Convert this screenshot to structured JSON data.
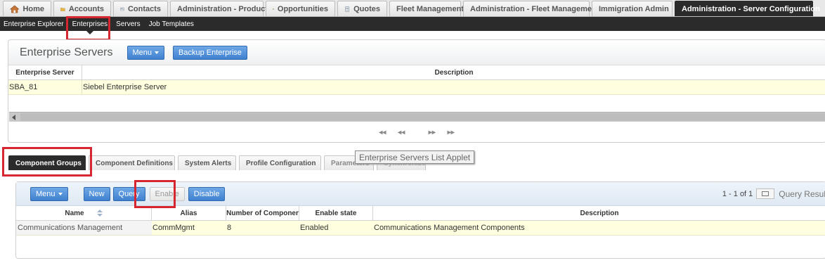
{
  "top_tabs": [
    {
      "label": "Home",
      "icon": "home-icon"
    },
    {
      "label": "Accounts",
      "icon": "folder-icon"
    },
    {
      "label": "Contacts",
      "icon": "contacts-icon"
    },
    {
      "label": "Administration - Product",
      "icon": ""
    },
    {
      "label": "Opportunities",
      "icon": "opportunities-icon"
    },
    {
      "label": "Quotes",
      "icon": "quotes-icon"
    },
    {
      "label": "Fleet Management",
      "icon": ""
    },
    {
      "label": "Administration - Fleet Management",
      "icon": ""
    },
    {
      "label": "Immigration Admin",
      "icon": ""
    },
    {
      "label": "Administration - Server Configuration",
      "icon": ""
    }
  ],
  "subnav": [
    "Enterprise Explorer",
    "Enterprises",
    "Servers",
    "Job Templates"
  ],
  "enterprise_applet": {
    "title": "Enterprise Servers",
    "menu_label": "Menu",
    "backup_label": "Backup Enterprise",
    "columns": [
      "Enterprise Server",
      "Description"
    ],
    "rows": [
      {
        "server": "SBA_81",
        "description": "Siebel Enterprise Server"
      }
    ]
  },
  "tooltip": "Enterprise Servers List Applet",
  "lower_tabs": [
    "Component Groups",
    "Component Definitions",
    "System Alerts",
    "Profile Configuration",
    "Parameters",
    "Synchronize"
  ],
  "component_applet": {
    "menu_label": "Menu",
    "new_label": "New",
    "query_label": "Query",
    "enable_label": "Enable",
    "disable_label": "Disable",
    "record_count": "1 - 1 of 1",
    "query_results": "Query Resul",
    "columns": [
      "Name",
      "Alias",
      "Number of Componer",
      "Enable state",
      "Description"
    ],
    "rows": [
      {
        "name": "Communications Management",
        "alias": "CommMgmt",
        "count": "8",
        "state": "Enabled",
        "description": "Communications Management Components"
      }
    ]
  },
  "colors": {
    "accent": "#3f80cf",
    "highlight": "#d6262f",
    "row_selected": "#ffffe0",
    "nav_dark": "#2b2b2b"
  }
}
